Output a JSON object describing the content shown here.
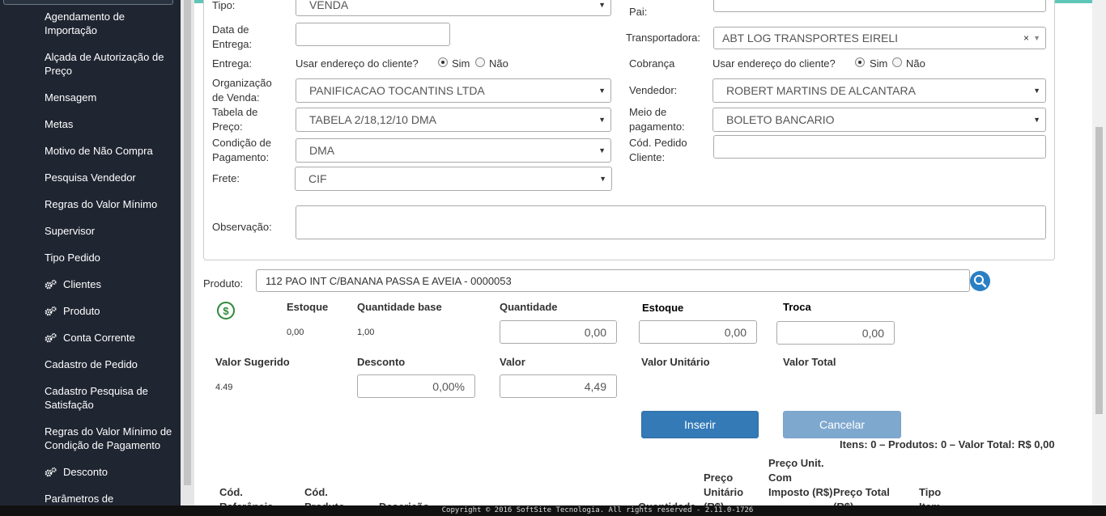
{
  "sidebar": {
    "items": [
      {
        "label": "Agendamento de Importação",
        "icon": false
      },
      {
        "label": "Alçada de Autorização de Preço",
        "icon": false
      },
      {
        "label": "Mensagem",
        "icon": false
      },
      {
        "label": "Metas",
        "icon": false
      },
      {
        "label": "Motivo de Não Compra",
        "icon": false
      },
      {
        "label": "Pesquisa Vendedor",
        "icon": false
      },
      {
        "label": "Regras do Valor Mínimo",
        "icon": false
      },
      {
        "label": "Supervisor",
        "icon": false
      },
      {
        "label": "Tipo Pedido",
        "icon": false
      },
      {
        "label": "Clientes",
        "icon": "gears-icon"
      },
      {
        "label": "Produto",
        "icon": "gears-icon"
      },
      {
        "label": "Conta Corrente",
        "icon": "gears-icon"
      },
      {
        "label": "Cadastro de Pedido",
        "icon": false
      },
      {
        "label": "Cadastro Pesquisa de Satisfação",
        "icon": false
      },
      {
        "label": "Regras do Valor Mínimo de Condição de Pagamento",
        "icon": false
      },
      {
        "label": "Desconto",
        "icon": "gears-icon"
      },
      {
        "label": "Parâmetros de",
        "icon": false
      }
    ]
  },
  "form": {
    "tipo_label": "Tipo:",
    "tipo_value": "VENDA",
    "pai_label": "Pai:",
    "data_entrega_label": "Data de Entrega:",
    "data_entrega_value": "",
    "transportadora_label": "Transportadora:",
    "transportadora_value": "ABT LOG TRANSPORTES EIRELI",
    "entrega_label": "Entrega:",
    "usar_endereco_label": "Usar endereço do cliente?",
    "sim_label": "Sim",
    "nao_label": "Não",
    "cobranca_label": "Cobrança",
    "org_venda_label": "Organização de Venda:",
    "org_venda_value": "PANIFICACAO TOCANTINS LTDA",
    "vendedor_label": "Vendedor:",
    "vendedor_value": "ROBERT MARTINS DE ALCANTARA",
    "tabela_preco_label": "Tabela de Preço:",
    "tabela_preco_value": "TABELA 2/18,12/10 DMA",
    "meio_pagamento_label": "Meio de pagamento:",
    "meio_pagamento_value": "BOLETO BANCARIO",
    "condicao_label": "Condição de Pagamento:",
    "condicao_value": "DMA",
    "cod_pedido_label": "Cód. Pedido Cliente:",
    "cod_pedido_value": "",
    "frete_label": "Frete:",
    "frete_value": "CIF",
    "observacao_label": "Observação:",
    "observacao_value": ""
  },
  "produto": {
    "label": "Produto:",
    "value": "112 PAO INT C/BANANA PASSA E AVEIA - 0000053",
    "estoque_label": "Estoque",
    "estoque_value": "0,00",
    "qtd_base_label": "Quantidade base",
    "qtd_base_value": "1,00",
    "quantidade_label": "Quantidade",
    "quantidade_value": "0,00",
    "estoque2_label": "Estoque",
    "estoque2_value": "0,00",
    "troca_label": "Troca",
    "troca_value": "0,00",
    "valor_sugerido_label": "Valor Sugerido",
    "valor_sugerido_value": "4.49",
    "desconto_label": "Desconto",
    "desconto_value": "0,00%",
    "valor_label": "Valor",
    "valor_value": "4,49",
    "valor_unitario_label": "Valor Unitário",
    "valor_total_label": "Valor Total",
    "inserir_label": "Inserir",
    "cancelar_label": "Cancelar",
    "summary": "Itens: 0 – Produtos: 0 – Valor Total: R$ 0,00"
  },
  "table": {
    "headers": [
      "Cód. Referência",
      "Cód. Produto",
      "Descrição",
      "Quantidade",
      "Preço Unitário (R$)",
      "Preço Unit. Com Imposto (R$)",
      "Preço Total (R$)",
      "Tipo Item"
    ]
  },
  "footer": {
    "text": "Copyright © 2016 SoftSite Tecnologia. All rights reserved - 2.11.0-1726"
  },
  "colors": {
    "sidebar_bg": "#1f2531",
    "primary": "#337ab7",
    "teal_accent": "#5ec6b8",
    "money_icon": "#2e8b3a",
    "search_button": "#2a7fc4"
  }
}
